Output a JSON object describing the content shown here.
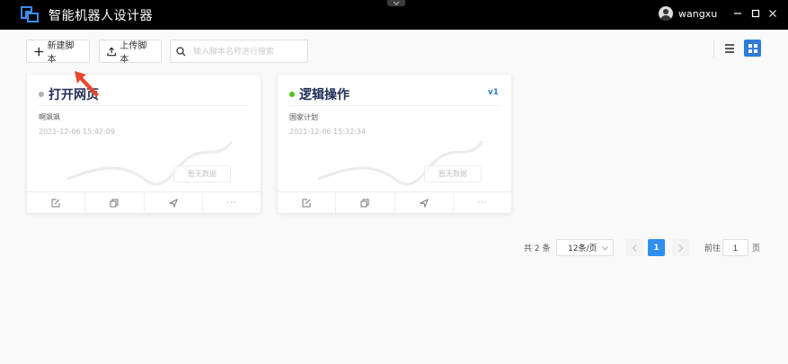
{
  "window": {
    "title": "智能机器人设计器",
    "username": "wangxu"
  },
  "toolbar": {
    "new_script": "新建脚本",
    "upload_script": "上传脚本",
    "search_placeholder": "输入脚本名称进行搜索"
  },
  "cards": [
    {
      "title": "打开网页",
      "status_color": "#b0b0b0",
      "version": "",
      "description": "啊飒飒",
      "date": "2021-12-06 15:42:09",
      "no_data": "暂无数据"
    },
    {
      "title": "逻辑操作",
      "status_color": "#52c41a",
      "version": "v1",
      "description": "国家计划",
      "date": "2021-12-06 15:32:34",
      "no_data": "暂无数据"
    }
  ],
  "card_actions": [
    "edit-icon",
    "copy-icon",
    "send-icon",
    "more-icon"
  ],
  "card_more": "···",
  "pagination": {
    "total": "共 2 条",
    "page_size": "12条/页",
    "current": "1",
    "goto_label": "前往",
    "goto_value": "1",
    "page_label": "页"
  },
  "colors": {
    "accent": "#2f7bd8",
    "titlebar": "#000000",
    "annotation_arrow": "#e8482c"
  }
}
